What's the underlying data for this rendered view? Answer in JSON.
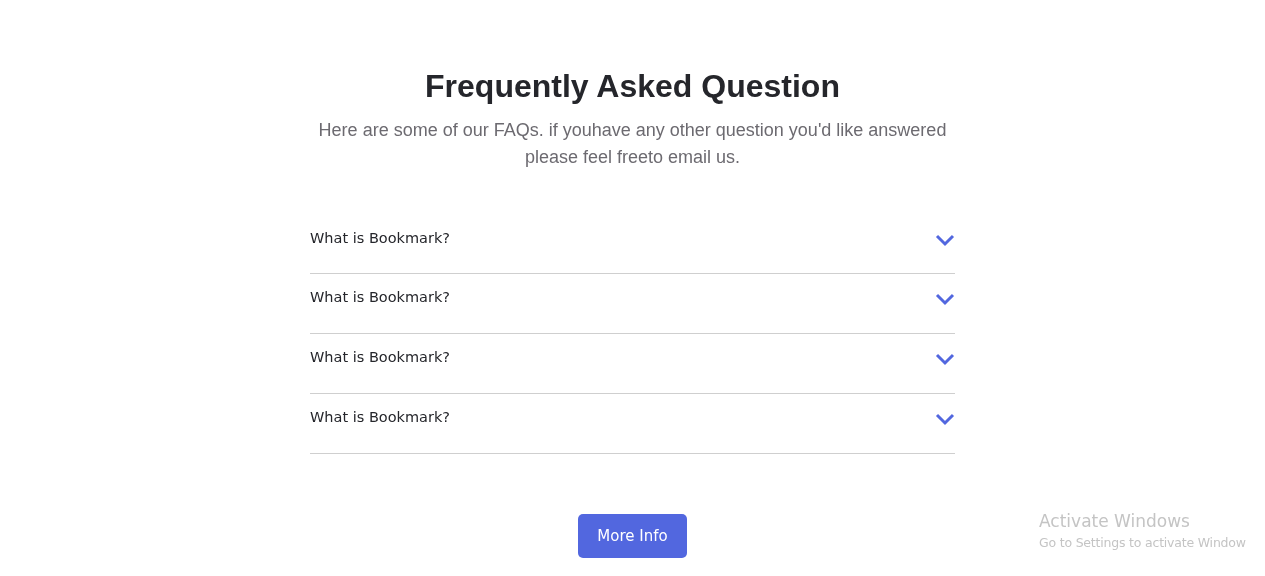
{
  "title": "Frequently Asked Question",
  "subtitle": "Here are some of our FAQs. if youhave any other question you'd like answered please feel freeto email us.",
  "faqs": [
    {
      "question": "What is Bookmark?",
      "expanded": false
    },
    {
      "question": "What is Bookmark?",
      "expanded": false
    },
    {
      "question": "What is Bookmark?",
      "expanded": false
    },
    {
      "question": "What is Bookmark?",
      "expanded": false
    }
  ],
  "button": "More Info",
  "os_notice": {
    "title": "Activate Windows",
    "text": "Go to Settings to activate Window"
  }
}
